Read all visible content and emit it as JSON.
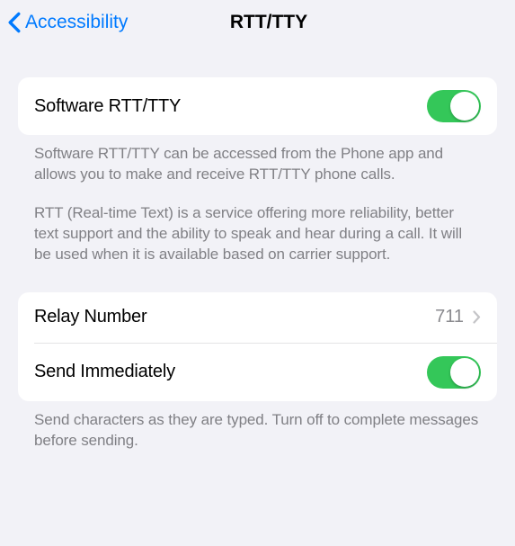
{
  "nav": {
    "back_label": "Accessibility",
    "title": "RTT/TTY"
  },
  "group1": {
    "software_label": "Software RTT/TTY",
    "software_on": true,
    "footer_p1": "Software RTT/TTY can be accessed from the Phone app and allows you to make and receive RTT/TTY phone calls.",
    "footer_p2": "RTT (Real-time Text) is a service offering more reliability, better text support and the ability to speak and hear during a call. It will be used when it is available based on carrier support."
  },
  "group2": {
    "relay_label": "Relay Number",
    "relay_value": "711",
    "send_label": "Send Immediately",
    "send_on": true,
    "footer": "Send characters as they are typed. Turn off to complete messages before sending."
  },
  "colors": {
    "accent": "#007aff",
    "toggle_on": "#34c759",
    "bg": "#f2f2f7"
  }
}
